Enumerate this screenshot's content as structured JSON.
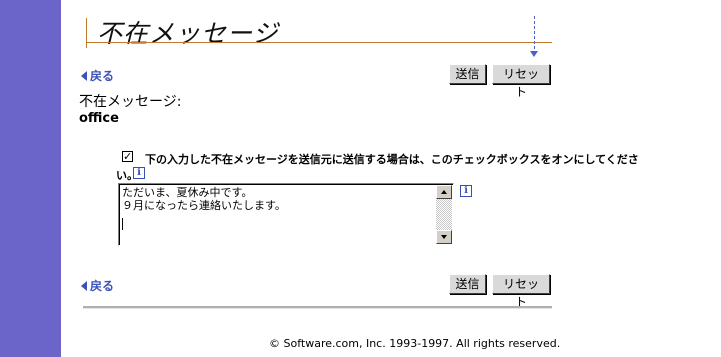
{
  "page": {
    "title": "不在メッセージ",
    "accent_color": "#6b65c9",
    "link_color": "#3d52b8"
  },
  "nav": {
    "back_label": "戻る"
  },
  "toolbar": {
    "send_label": "送信",
    "reset_label": "リセット"
  },
  "form": {
    "message_label": "不在メッセージ:",
    "account": "office",
    "checkbox_checked": true,
    "checkbox_mark": "✓",
    "checkbox_text_line1": "下の入力した不在メッセージを送信元に送信する場合は、このチェックボックスをオンにしてくださ",
    "checkbox_text_line2": "い。",
    "info_icon_glyph": "i",
    "message_text": "ただいま、夏休み中です。\n９月になったら連絡いたします。"
  },
  "footer": {
    "copyright": "© Software.com, Inc. 1993-1997. All rights reserved."
  }
}
